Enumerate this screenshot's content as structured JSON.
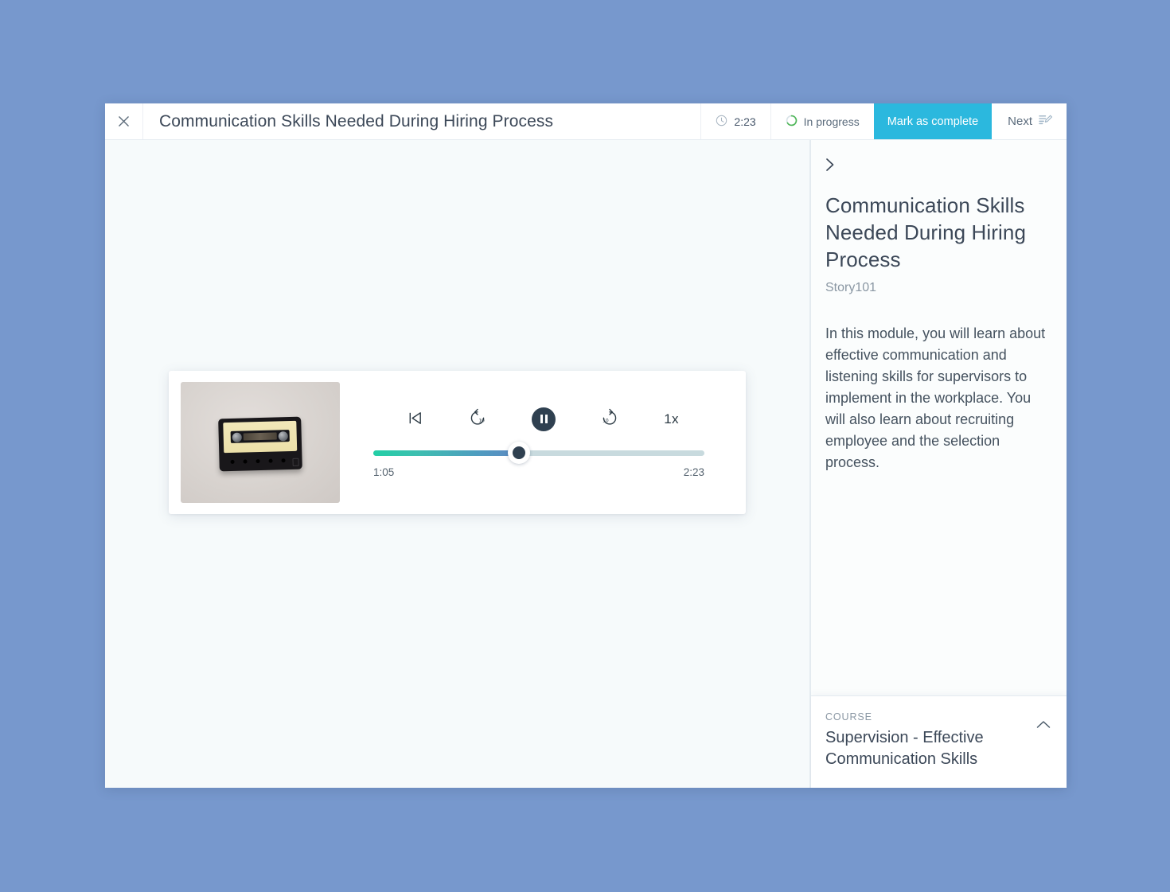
{
  "window": {
    "topbar": {
      "close_icon": "close-icon",
      "title": "Communication Skills Needed During Hiring Process",
      "duration_icon": "clock-icon",
      "duration": "2:23",
      "status_icon": "progress-ring-icon",
      "status": "In progress",
      "mark_complete_label": "Mark as complete",
      "next_label": "Next",
      "next_icon": "assignment-edit-icon"
    },
    "player": {
      "thumbnail_alt": "cassette-tape-photo",
      "controls": {
        "skip_start_label": "skip-to-start",
        "rewind_label": "10",
        "play_pause_label": "pause",
        "forward_label": "10",
        "speed_label": "1x"
      },
      "elapsed": "1:05",
      "total": "2:23",
      "progress_percent": 44
    },
    "sidebar": {
      "collapse_icon": "chevron-right-icon",
      "title": "Communication Skills Needed During Hiring Process",
      "subtitle": "Story101",
      "description": "In this module, you will learn about effective communication and listening skills for supervisors to implement in the workplace. You will also learn about recruiting employee and the selection process.",
      "course_card": {
        "eyebrow": "COURSE",
        "name": "Supervision - Effective Communication Skills",
        "toggle_icon": "chevron-up-icon"
      }
    }
  },
  "colors": {
    "page_background": "#7798cd",
    "stage_background": "#f6fafb",
    "accent_cyan": "#2bb8de",
    "progress_green": "#22cfa6",
    "progress_blue": "#5d89c2",
    "status_green": "#4fb758",
    "text_dark": "#3c4858",
    "text_muted": "#8a97a3"
  }
}
